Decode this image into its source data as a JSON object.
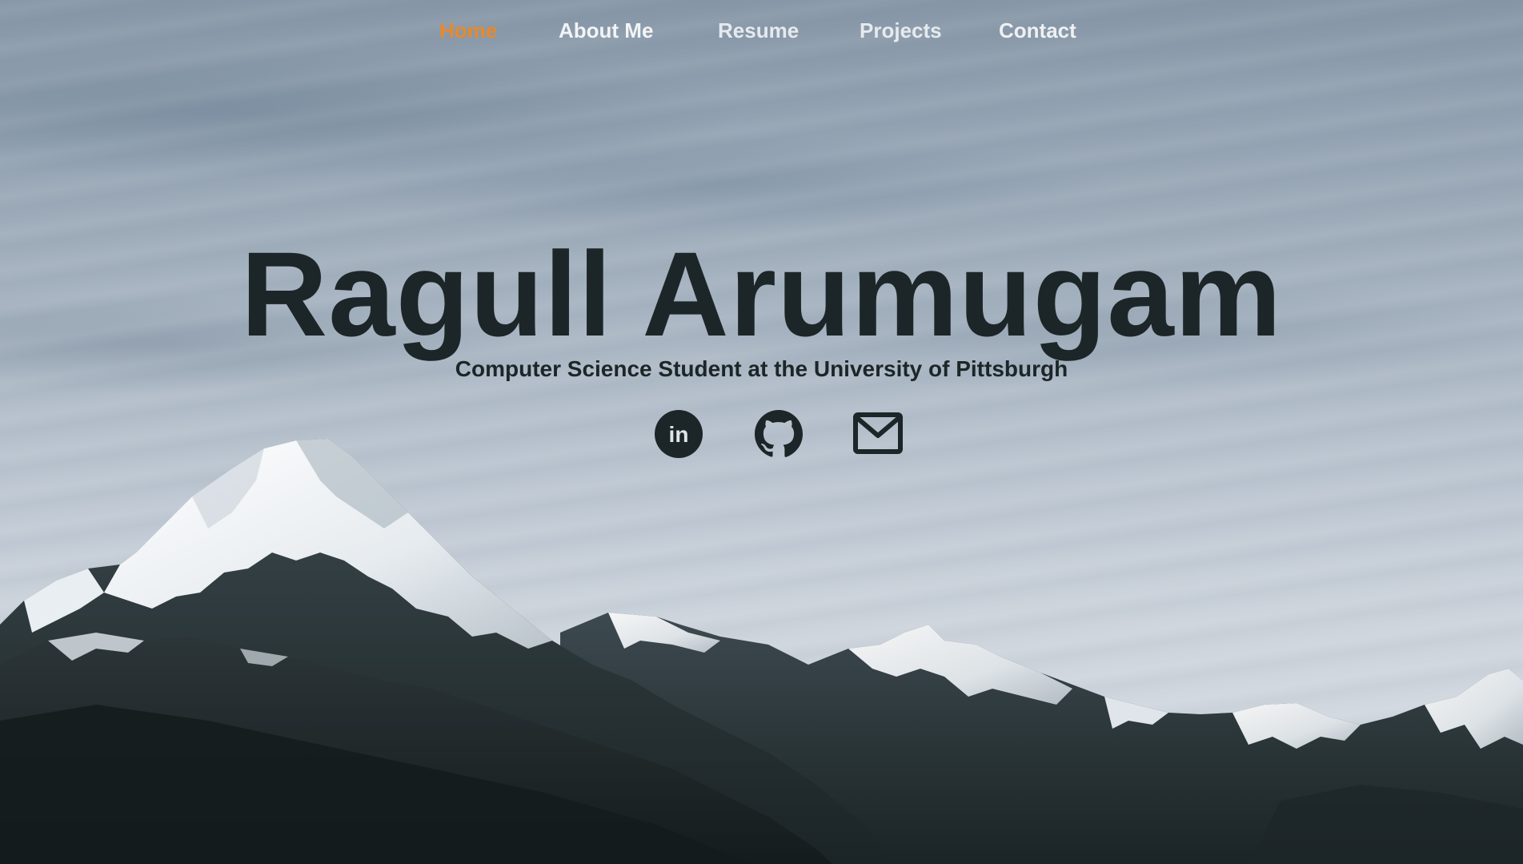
{
  "nav": {
    "items": [
      {
        "label": "Home",
        "active": true
      },
      {
        "label": "About Me",
        "active": false
      },
      {
        "label": "Resume",
        "active": false
      },
      {
        "label": "Projects",
        "active": false
      },
      {
        "label": "Contact",
        "active": false
      }
    ],
    "active_color": "#e8892b",
    "text_color": "#f2f4f6"
  },
  "hero": {
    "name": "Ragull Arumugam",
    "tagline": "Computer Science Student at the University of Pittsburgh",
    "text_color": "#1c2628"
  },
  "social": [
    {
      "icon": "linkedin-icon",
      "glyph_text": "in"
    },
    {
      "icon": "github-icon"
    },
    {
      "icon": "email-icon"
    }
  ]
}
